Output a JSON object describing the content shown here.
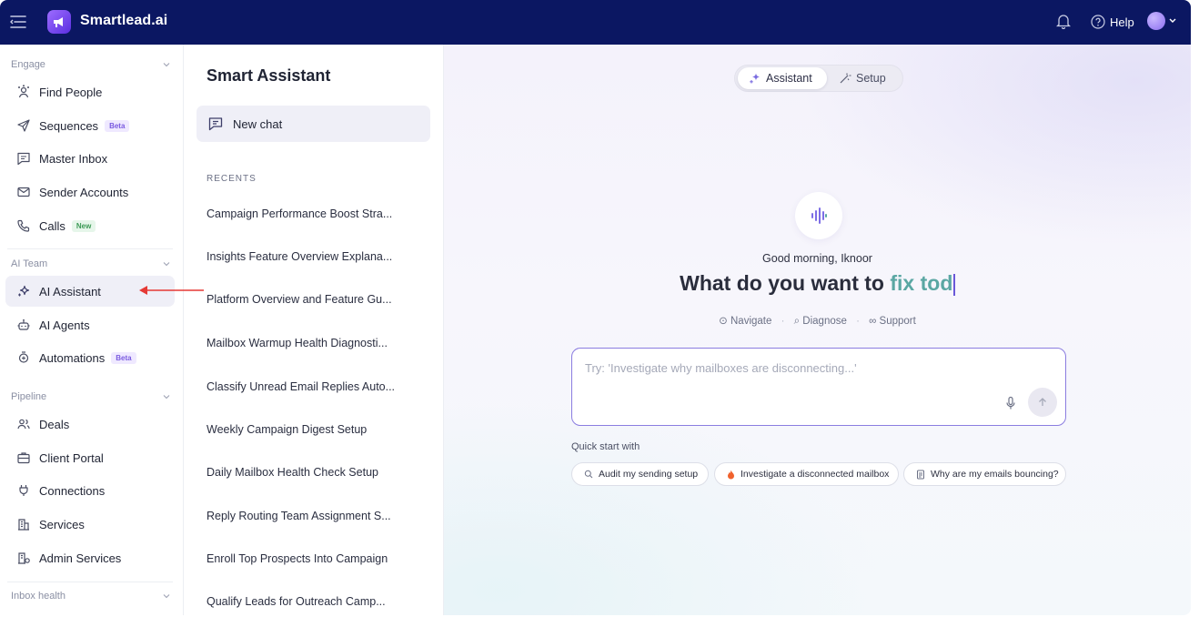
{
  "app": {
    "brand": "Smartlead.ai",
    "help_label": "Help"
  },
  "sidebar": {
    "sections": [
      {
        "label": "Engage"
      },
      {
        "label": "AI Team"
      },
      {
        "label": "Pipeline"
      },
      {
        "label": "Inbox health"
      }
    ],
    "items": [
      {
        "label": "Find People",
        "icon": "users-search-icon"
      },
      {
        "label": "Sequences",
        "icon": "send-icon",
        "badge": "Beta"
      },
      {
        "label": "Master Inbox",
        "icon": "inbox-message-icon"
      },
      {
        "label": "Sender Accounts",
        "icon": "mail-icon"
      },
      {
        "label": "Calls",
        "icon": "phone-icon",
        "badge": "New"
      },
      {
        "label": "AI Assistant",
        "icon": "sparkle-icon",
        "active": true
      },
      {
        "label": "AI Agents",
        "icon": "robot-icon"
      },
      {
        "label": "Automations",
        "icon": "automation-icon",
        "badge": "Beta"
      },
      {
        "label": "Deals",
        "icon": "people-icon"
      },
      {
        "label": "Client Portal",
        "icon": "briefcase-icon"
      },
      {
        "label": "Connections",
        "icon": "plug-icon"
      },
      {
        "label": "Services",
        "icon": "building-icon"
      },
      {
        "label": "Admin Services",
        "icon": "admin-building-icon"
      }
    ]
  },
  "chat_panel": {
    "title": "Smart Assistant",
    "new_chat": "New chat",
    "recents_label": "RECENTS",
    "recents": [
      "Campaign Performance Boost Stra...",
      "Insights Feature Overview Explana...",
      "Platform Overview and Feature Gu...",
      "Mailbox Warmup Health Diagnosti...",
      "Classify Unread Email Replies Auto...",
      "Weekly Campaign Digest Setup",
      "Daily Mailbox Health Check Setup",
      "Reply Routing Team Assignment S...",
      "Enroll Top Prospects Into Campaign",
      "Qualify Leads for Outreach Camp..."
    ]
  },
  "main": {
    "tabs": [
      {
        "label": "Assistant",
        "active": true
      },
      {
        "label": "Setup",
        "active": false
      }
    ],
    "greeting": "Good morning, Iknoor",
    "headline_prefix": "What do you want to ",
    "headline_highlight": "fix tod",
    "modes": [
      "Navigate",
      "Diagnose",
      "Support"
    ],
    "input_placeholder": "Try: 'Investigate why mailboxes are disconnecting...'",
    "quick_start_label": "Quick start with",
    "quick_starts": [
      "Audit my sending setup",
      "Investigate a disconnected mailbox",
      "Why are my emails bouncing?"
    ]
  },
  "colors": {
    "topbar": "#0b1762",
    "accent": "#8b7de0",
    "highlight": "#5aa7a3",
    "annotation_arrow": "#e53935"
  }
}
